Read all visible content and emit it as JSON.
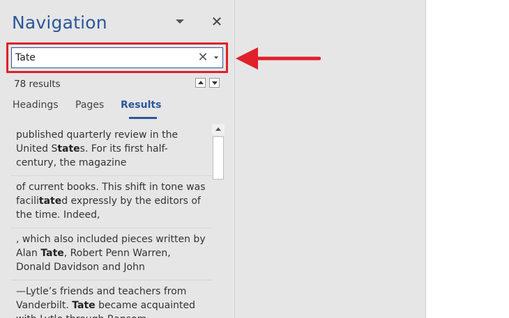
{
  "pane": {
    "title": "Navigation",
    "close_glyph": "✕"
  },
  "search": {
    "value": "Tate",
    "clear_glyph": "✕"
  },
  "results_count": "78 results",
  "tabs": [
    {
      "label": "Headings"
    },
    {
      "label": "Pages"
    },
    {
      "label": "Results",
      "active": true
    }
  ],
  "results": [
    {
      "before": "published quarterly review in the United S",
      "match": "tate",
      "after": "s. For its first half-century, the magazine"
    },
    {
      "before": "of current books. This shift in tone was facili",
      "match": "tate",
      "after": "d expressly by the editors of the time. Indeed,"
    },
    {
      "before": ", which also included pieces written by Alan ",
      "match": "Tate",
      "after": ", Robert Penn Warren, Donald Davidson and John"
    },
    {
      "before": "—Lytle’s friends and teachers from Vanderbilt. ",
      "match": "Tate",
      "after": " became acquainted with Lytle through Ransom"
    }
  ],
  "colors": {
    "accent": "#2b579a",
    "highlight": "#e0202a"
  },
  "icons": [
    "chevron-down-icon",
    "close-icon",
    "clear-icon",
    "arrow-up-icon",
    "arrow-down-icon",
    "red-arrow-icon"
  ]
}
